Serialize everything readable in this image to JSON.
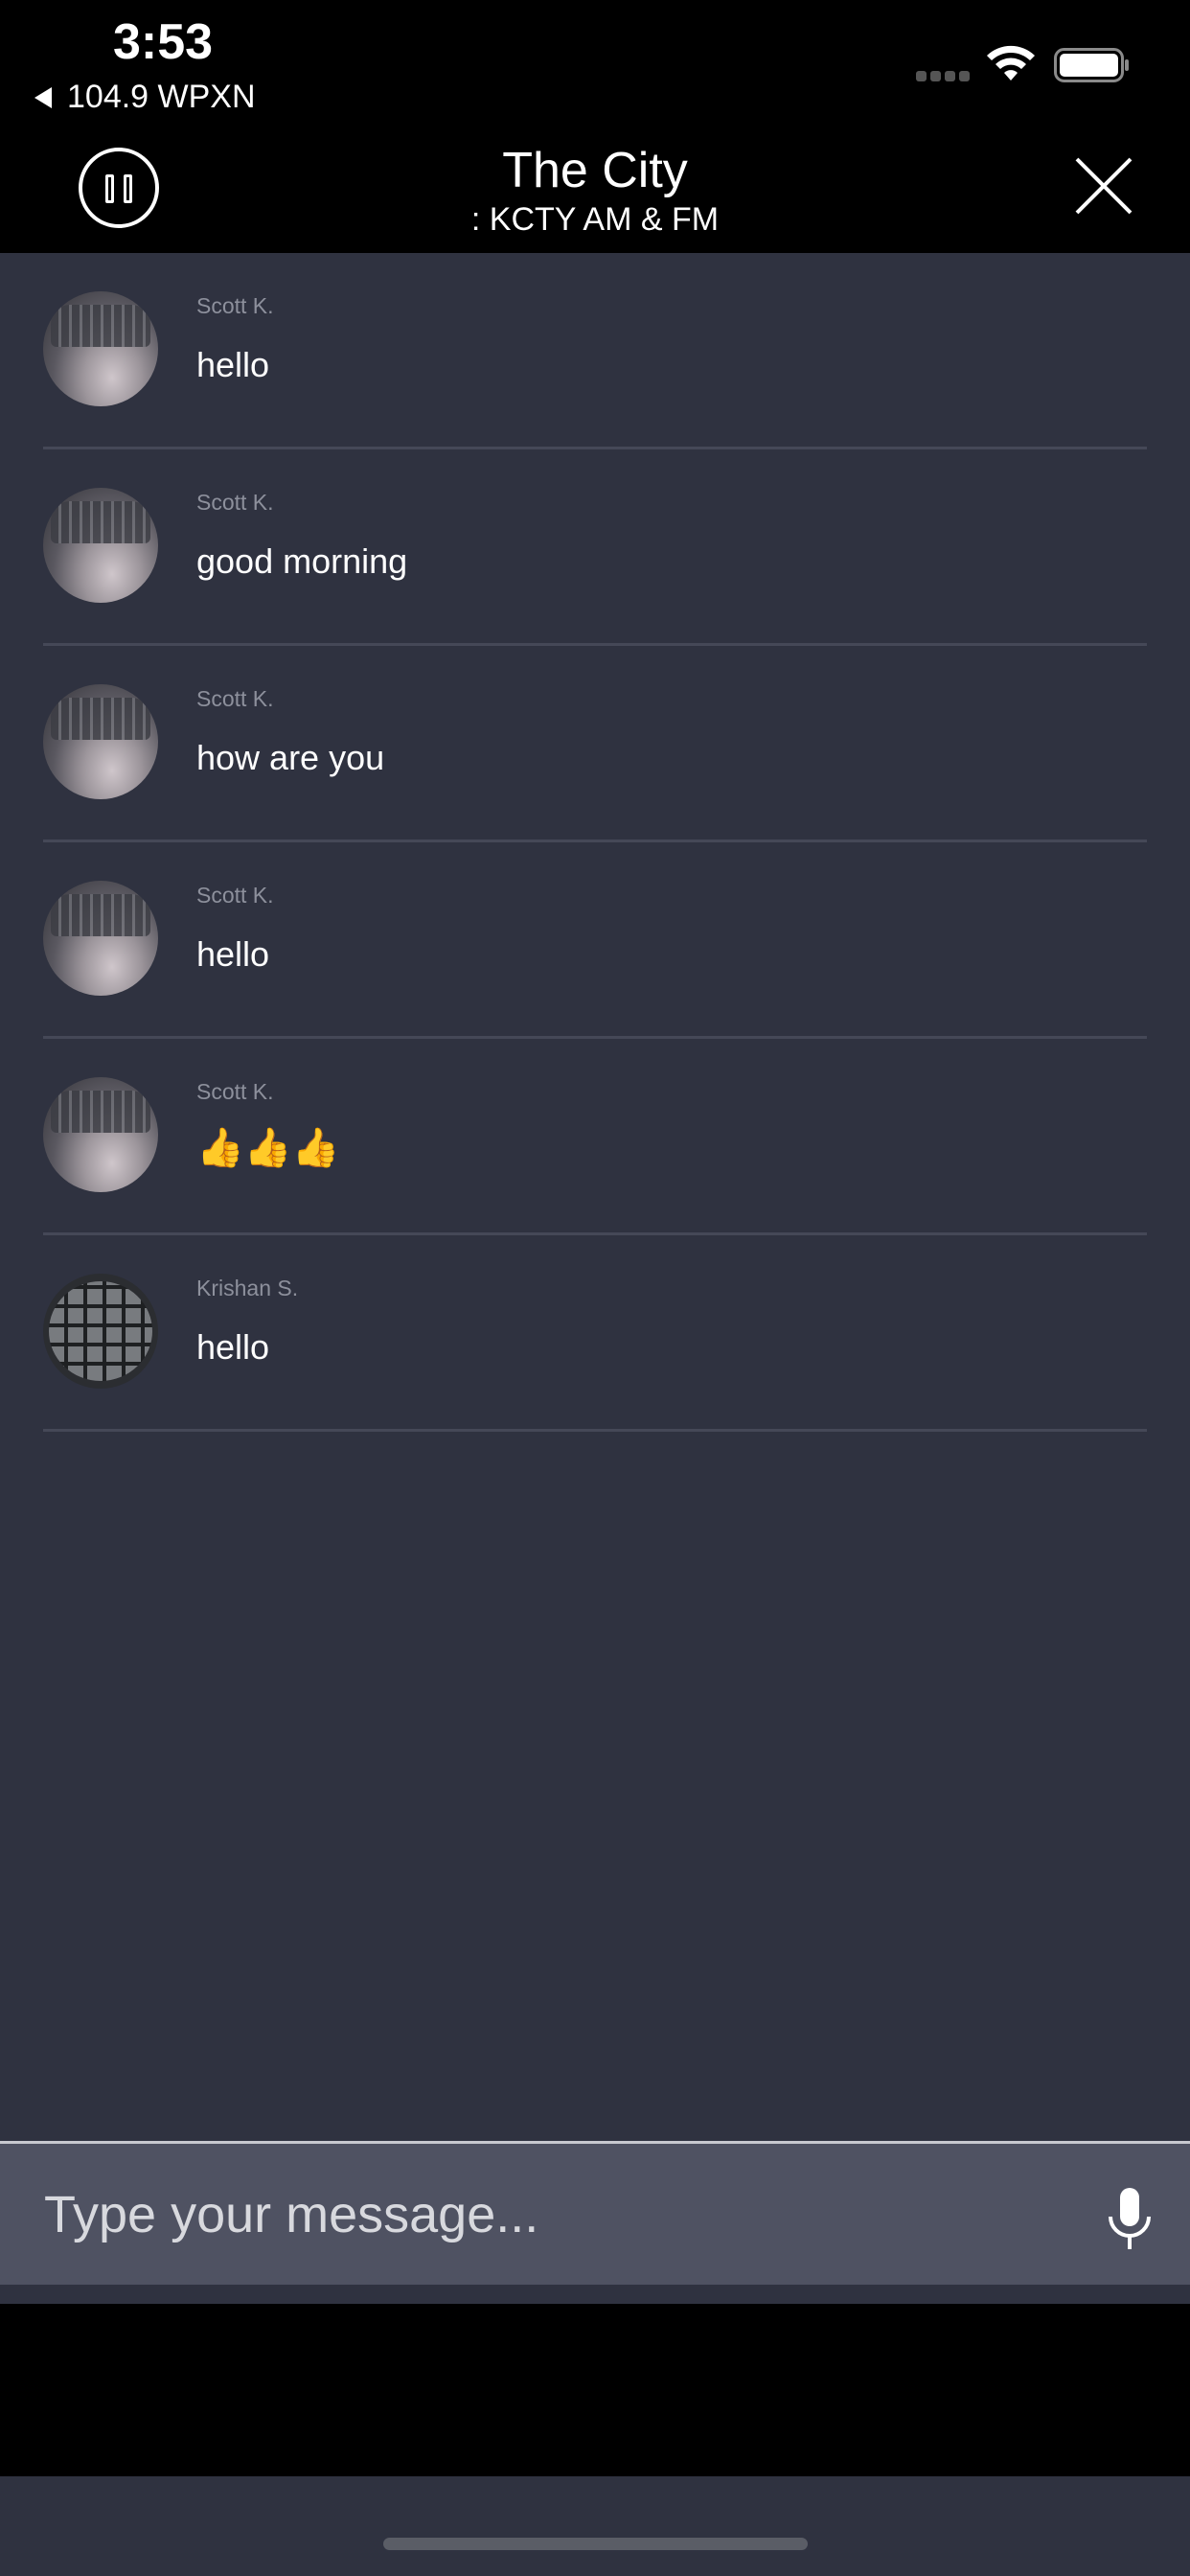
{
  "status_bar": {
    "time": "3:53",
    "back_app": "104.9 WPXN"
  },
  "header": {
    "title": "The City",
    "subtitle": ": KCTY AM & FM"
  },
  "messages": [
    {
      "sender": "Scott K.",
      "text": "hello",
      "avatar": "keyboard-photo-avatar"
    },
    {
      "sender": "Scott K.",
      "text": "good morning",
      "avatar": "keyboard-photo-avatar"
    },
    {
      "sender": "Scott K.",
      "text": "how are you",
      "avatar": "keyboard-photo-avatar"
    },
    {
      "sender": "Scott K.",
      "text": "hello",
      "avatar": "keyboard-photo-avatar"
    },
    {
      "sender": "Scott K.",
      "text": "👍👍👍",
      "avatar": "keyboard-photo-avatar"
    },
    {
      "sender": "Krishan S.",
      "text": "hello",
      "avatar": "keyboard-closeup-avatar"
    }
  ],
  "composer": {
    "placeholder": "Type your message...",
    "value": ""
  },
  "colors": {
    "background": "#2f3240",
    "header": "#000000",
    "composer": "#4f5262",
    "divider": "#454857",
    "sender_text": "#8d909c"
  },
  "icons": {
    "pause": "pause-icon",
    "close": "close-icon",
    "mic": "microphone-icon",
    "wifi": "wifi-icon",
    "battery": "battery-icon",
    "signal": "signal-icon",
    "back": "back-arrow-icon"
  }
}
